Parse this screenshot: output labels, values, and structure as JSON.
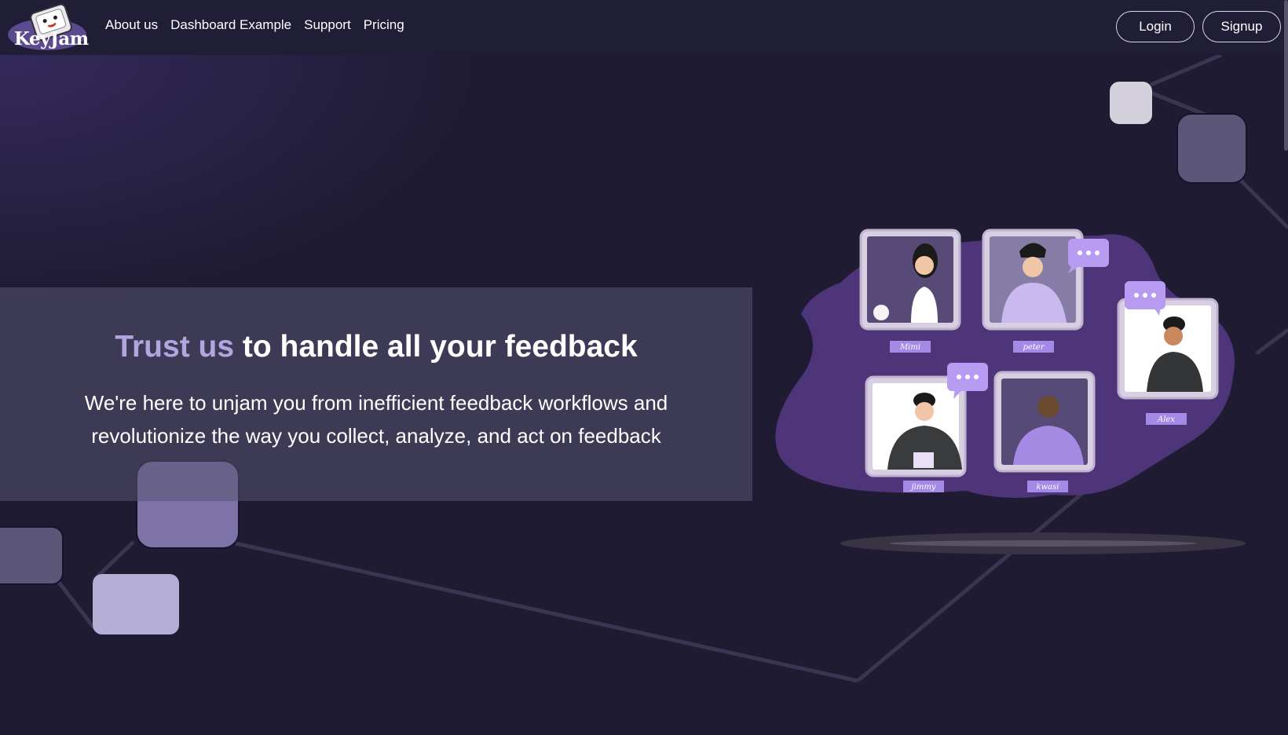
{
  "nav": {
    "logo_text": "KeyJam",
    "links": [
      "About us",
      "Dashboard Example",
      "Support",
      "Pricing"
    ],
    "login_label": "Login",
    "signup_label": "Signup"
  },
  "hero": {
    "title_accent": "Trust us",
    "title_rest": " to handle all your feedback",
    "subtitle": "We're here to unjam you from inefficient feedback workflows and revolutionize the way you collect, analyze, and act on feedback"
  },
  "illustration": {
    "names": [
      "Mimi",
      "peter",
      "Alex",
      "jimmy",
      "kwasi"
    ]
  },
  "colors": {
    "background": "#1e1b33",
    "navbar": "#201d37",
    "accent": "#b3a6de",
    "blob": "#4e3478",
    "bubble": "#b89cf2"
  }
}
